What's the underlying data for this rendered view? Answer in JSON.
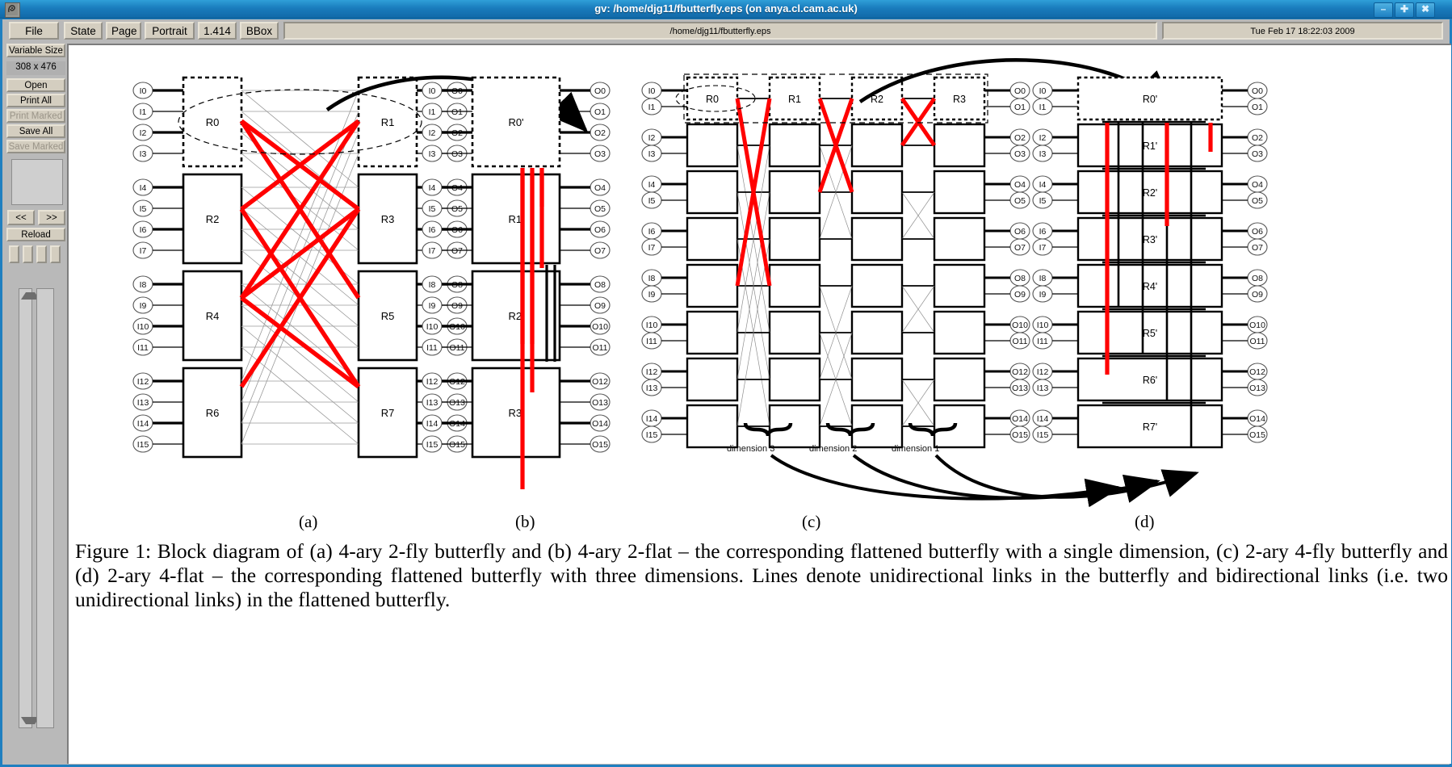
{
  "window": {
    "title": "gv: /home/djg11/fbutterfly.eps (on anya.cl.cam.ac.uk)",
    "app_icon": "ghostscript-icon",
    "minimize_label": "–",
    "maximize_label": "✚",
    "close_label": "✖"
  },
  "toolbar": {
    "buttons": [
      {
        "label": "File",
        "name": "file-menu-button"
      },
      {
        "label": "State",
        "name": "state-menu-button"
      },
      {
        "label": "Page",
        "name": "page-menu-button"
      },
      {
        "label": "Portrait",
        "name": "orientation-menu-button"
      },
      {
        "label": "1.414",
        "name": "scale-menu-button"
      },
      {
        "label": "BBox",
        "name": "bbox-menu-button"
      }
    ],
    "filename_field": "/home/djg11/fbutterfly.eps",
    "date_field": "Tue Feb 17 18:22:03 2009"
  },
  "sidebar": {
    "size_mode_label": "Variable Size",
    "page_size_value": "308 x 476",
    "buttons": [
      {
        "label": "Open",
        "name": "open-button",
        "enabled": true
      },
      {
        "label": "Print All",
        "name": "print-all-button",
        "enabled": true
      },
      {
        "label": "Print Marked",
        "name": "print-marked-button",
        "enabled": false
      },
      {
        "label": "Save All",
        "name": "save-all-button",
        "enabled": true
      },
      {
        "label": "Save Marked",
        "name": "save-marked-button",
        "enabled": false
      }
    ],
    "prev_label": "<<",
    "next_label": ">>",
    "reload_label": "Reload"
  },
  "figure": {
    "caption": "Figure 1: Block diagram of (a) 4-ary 2-fly butterfly and (b) 4-ary 2-flat – the corresponding flattened butterfly with a single dimension, (c) 2-ary 4-fly butterfly and (d) 2-ary 4-flat – the corresponding flattened butterfly with three dimensions. Lines denote unidirectional links in the butterfly and bidirectional links (i.e. two unidirectional links) in the flattened butterfly.",
    "panel_labels": [
      "(a)",
      "(b)",
      "(c)",
      "(d)"
    ],
    "dimension_labels": [
      "dimension 3",
      "dimension 2",
      "dimension 1"
    ],
    "panel_a": {
      "inputs": [
        "I0",
        "I1",
        "I2",
        "I3",
        "I4",
        "I5",
        "I6",
        "I7",
        "I8",
        "I9",
        "I10",
        "I11",
        "I12",
        "I13",
        "I14",
        "I15"
      ],
      "outputs": [
        "O0",
        "O1",
        "O2",
        "O3",
        "O4",
        "O5",
        "O6",
        "O7",
        "O8",
        "O9",
        "O10",
        "O11",
        "O12",
        "O13",
        "O14",
        "O15"
      ],
      "routers": [
        "R0",
        "R1",
        "R2",
        "R3",
        "R4",
        "R5",
        "R6",
        "R7"
      ]
    },
    "panel_b": {
      "inputs": [
        "I0",
        "I1",
        "I2",
        "I3",
        "I4",
        "I5",
        "I6",
        "I7",
        "I8",
        "I9",
        "I10",
        "I11",
        "I12",
        "I13",
        "I14",
        "I15"
      ],
      "outputs": [
        "O0",
        "O1",
        "O2",
        "O3",
        "O4",
        "O5",
        "O6",
        "O7",
        "O8",
        "O9",
        "O10",
        "O11",
        "O12",
        "O13",
        "O14",
        "O15"
      ],
      "routers": [
        "R0'",
        "R1'",
        "R2'",
        "R3'"
      ]
    },
    "panel_c": {
      "inputs": [
        "I0",
        "I1",
        "I2",
        "I3",
        "I4",
        "I5",
        "I6",
        "I7",
        "I8",
        "I9",
        "I10",
        "I11",
        "I12",
        "I13",
        "I14",
        "I15"
      ],
      "outputs": [
        "O0",
        "O1",
        "O2",
        "O3",
        "O4",
        "O5",
        "O6",
        "O7",
        "O8",
        "O9",
        "O10",
        "O11",
        "O12",
        "O13",
        "O14",
        "O15"
      ],
      "routers": [
        "R0",
        "R1",
        "R2",
        "R3"
      ]
    },
    "panel_d": {
      "inputs": [
        "I0",
        "I1",
        "I2",
        "I3",
        "I4",
        "I5",
        "I6",
        "I7",
        "I8",
        "I9",
        "I10",
        "I11",
        "I12",
        "I13",
        "I14",
        "I15"
      ],
      "outputs": [
        "O0",
        "O1",
        "O2",
        "O3",
        "O4",
        "O5",
        "O6",
        "O7",
        "O8",
        "O9",
        "O10",
        "O11",
        "O12",
        "O13",
        "O14",
        "O15"
      ],
      "routers": [
        "R0'",
        "R1'",
        "R2'",
        "R3'",
        "R4'",
        "R5'",
        "R6'",
        "R7'"
      ]
    },
    "colors": {
      "highlight": "#ff0000",
      "line": "#000000",
      "background": "#ffffff"
    }
  }
}
